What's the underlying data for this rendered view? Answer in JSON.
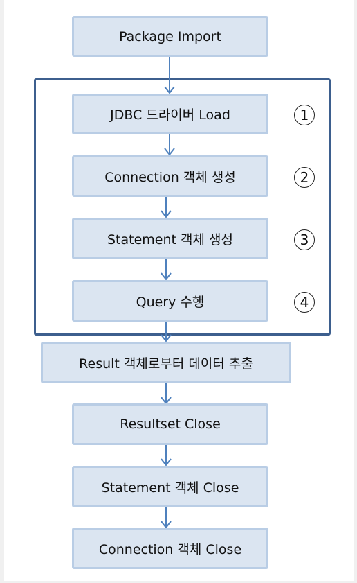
{
  "steps": [
    "Package Import",
    "JDBC 드라이버 Load",
    "Connection 객체 생성",
    "Statement 객체 생성",
    "Query 수행",
    "Result 객체로부터 데이터 추출",
    "Resultset Close",
    "Statement 객체 Close",
    "Connection 객체 Close"
  ],
  "markers": [
    "1",
    "2",
    "3",
    "4"
  ],
  "colors": {
    "box_fill": "#dbe5f1",
    "box_border": "#b9cde5",
    "arrow": "#4f81bd",
    "frame": "#3d5f8e"
  }
}
